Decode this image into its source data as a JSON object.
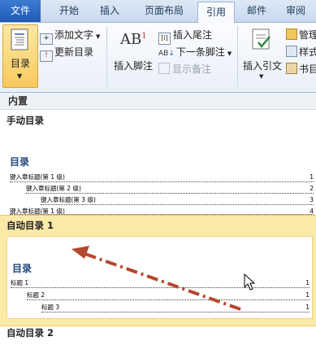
{
  "tabs": [
    {
      "label": "文件"
    },
    {
      "label": "开始"
    },
    {
      "label": "插入"
    },
    {
      "label": "页面布局"
    },
    {
      "label": "引用"
    },
    {
      "label": "邮件"
    },
    {
      "label": "审阅"
    }
  ],
  "ribbon": {
    "toc_button": "目录",
    "add_text": "添加文字",
    "update_toc": "更新目录",
    "insert_footnote": "插入脚注",
    "insert_endnote": "插入尾注",
    "next_footnote": "下一条脚注",
    "show_notes": "显示备注",
    "insert_citation": "插入引文",
    "manage": "管理",
    "style": "样式",
    "bibliography": "书目"
  },
  "gallery": {
    "header": "内置",
    "manual": {
      "title": "手动目录",
      "heading": "目录",
      "lines": [
        {
          "text": "键入章标题(第 1 级)",
          "page": "1"
        },
        {
          "text": "键入章标题(第 2 级)",
          "page": "2"
        },
        {
          "text": "键入章标题(第 3 级)",
          "page": "3"
        },
        {
          "text": "键入章标题(第 1 级)",
          "page": "4"
        }
      ]
    },
    "auto1": {
      "title": "自动目录 1",
      "heading": "目录",
      "lines": [
        {
          "text": "标题 1",
          "page": "1"
        },
        {
          "text": "标题 2",
          "page": "1"
        },
        {
          "text": "标题 3",
          "page": "1"
        }
      ]
    },
    "auto2": {
      "title": "自动目录 2"
    }
  },
  "colors": {
    "accent_blue": "#1f497d",
    "hover_band": "#fbe9a8",
    "arrow": "#b5472e"
  }
}
